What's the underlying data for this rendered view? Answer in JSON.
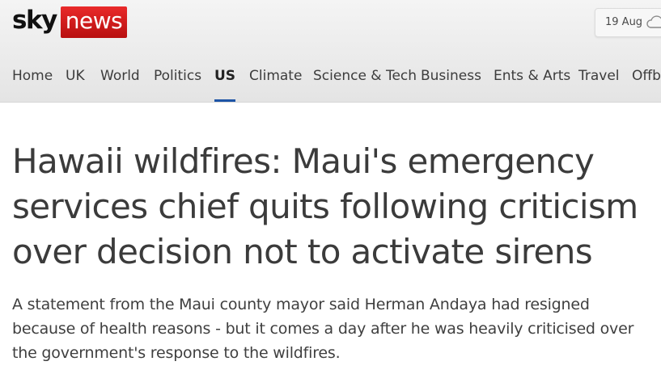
{
  "brand": {
    "sky": "sky",
    "news": "news",
    "news_color": "#d31e1e"
  },
  "weather": {
    "date": "19 Aug",
    "icon": "cloud-icon"
  },
  "nav": {
    "items": [
      "Home",
      "UK",
      "World",
      "Politics",
      "US",
      "Climate",
      "Science & Tech",
      "Business",
      "Ents & Arts",
      "Travel",
      "Offbeat"
    ],
    "active": "US",
    "active_color": "#1d54a6"
  },
  "article": {
    "headline": "Hawaii wildfires: Maui's emergency services chief quits following criticism over decision not to activate sirens",
    "standfirst": "A statement from the Maui county mayor said Herman Andaya had resigned because of health reasons - but it comes a day after he was heavily criticised over the government's response to the wildfires."
  }
}
